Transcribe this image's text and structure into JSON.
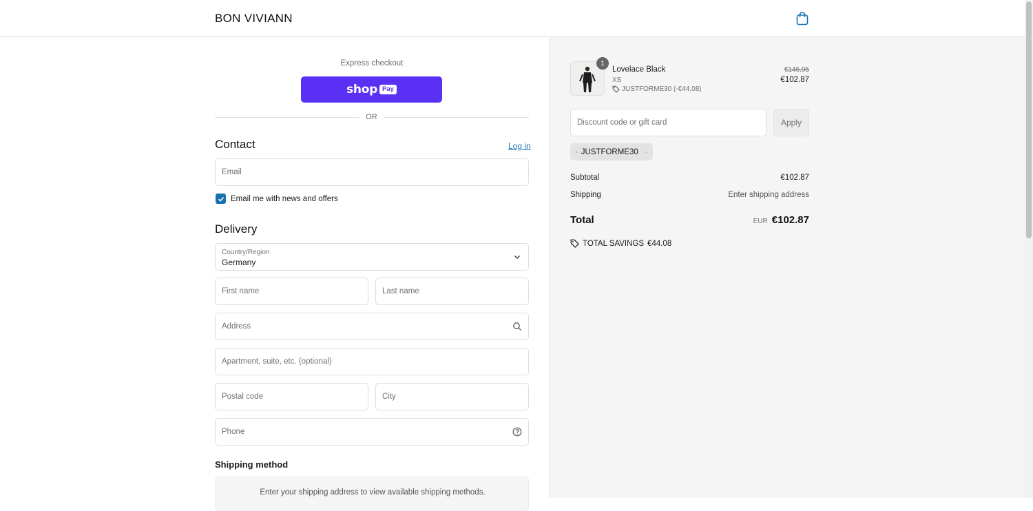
{
  "header": {
    "brand": "BON VIVIANN",
    "cart_icon": "shopping-bag-icon"
  },
  "express": {
    "label": "Express checkout",
    "shop_pay_word": "shop",
    "shop_pay_badge": "Pay",
    "or_text": "OR"
  },
  "contact": {
    "title": "Contact",
    "login_link": "Log in",
    "email_placeholder": "Email",
    "newsletter_label": "Email me with news and offers",
    "newsletter_checked": true
  },
  "delivery": {
    "title": "Delivery",
    "country_label": "Country/Region",
    "country_value": "Germany",
    "first_name_placeholder": "First name",
    "last_name_placeholder": "Last name",
    "address_placeholder": "Address",
    "apartment_placeholder": "Apartment, suite, etc. (optional)",
    "postal_placeholder": "Postal code",
    "city_placeholder": "City",
    "phone_placeholder": "Phone"
  },
  "shipping_method": {
    "title": "Shipping method",
    "message": "Enter your shipping address to view available shipping methods."
  },
  "summary": {
    "product": {
      "name": "Lovelace Black",
      "variant": "XS",
      "quantity": "1",
      "discount": "JUSTFORME30 (-€44.08)",
      "price_original": "€146.95",
      "price_final": "€102.87"
    },
    "discount_placeholder": "Discount code or gift card",
    "apply_label": "Apply",
    "applied_code": "JUSTFORME30",
    "subtotal_label": "Subtotal",
    "subtotal_value": "€102.87",
    "shipping_label": "Shipping",
    "shipping_value": "Enter shipping address",
    "total_label": "Total",
    "total_currency": "EUR",
    "total_value": "€102.87",
    "savings_label": "TOTAL SAVINGS",
    "savings_value": "€44.08"
  },
  "colors": {
    "accent": "#1773b0",
    "shop_pay": "#5a31f4"
  }
}
